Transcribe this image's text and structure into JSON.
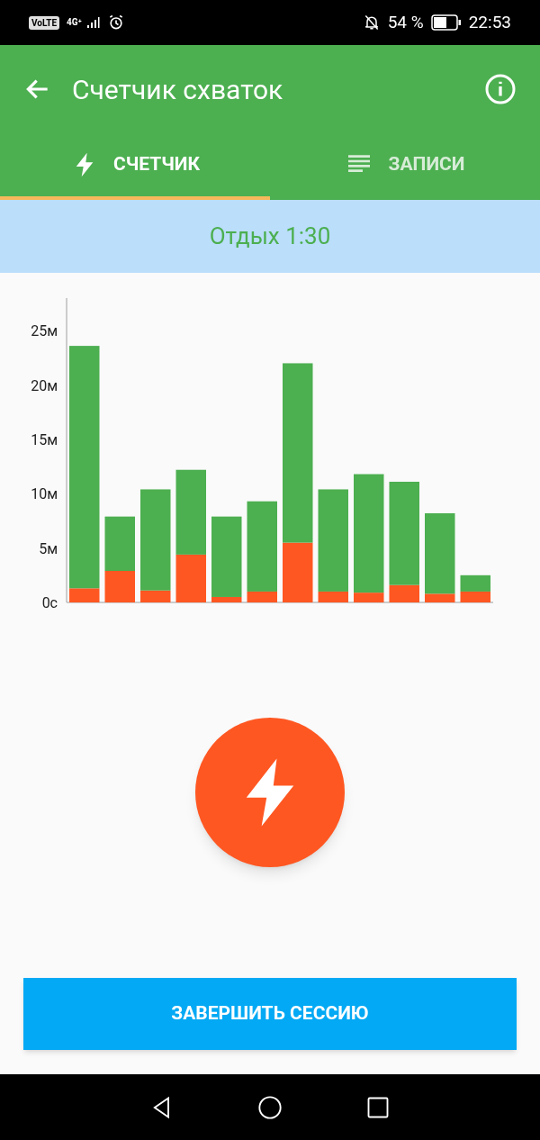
{
  "status_bar": {
    "volte": "VoLTE",
    "network": "4G⁺",
    "battery": "54 %",
    "time": "22:53"
  },
  "app_bar": {
    "title": "Счетчик схваток"
  },
  "tabs": [
    {
      "label": "СЧЕТЧИК",
      "kind": "bolt",
      "selected": true
    },
    {
      "label": "ЗАПИСИ",
      "kind": "lines",
      "selected": false
    }
  ],
  "banner": {
    "text": "Отдых 1:30"
  },
  "chart": {
    "chart_data": {
      "type": "bar",
      "stacked": true,
      "series": [
        {
          "color": "#ff5722",
          "values": [
            1.3,
            2.9,
            1.1,
            4.4,
            0.5,
            1.0,
            5.5,
            1.0,
            0.9,
            1.6,
            0.8,
            1.0
          ]
        },
        {
          "color": "#4caf50",
          "values": [
            22.3,
            5.0,
            9.3,
            7.8,
            7.4,
            8.3,
            16.5,
            9.4,
            10.9,
            9.5,
            7.4,
            1.5
          ]
        }
      ],
      "ylim": [
        0,
        28
      ],
      "yticks": [
        {
          "value": 0,
          "label": "0с"
        },
        {
          "value": 5,
          "label": "5м"
        },
        {
          "value": 10,
          "label": "10м"
        },
        {
          "value": 15,
          "label": "15м"
        },
        {
          "value": 20,
          "label": "20м"
        },
        {
          "value": 25,
          "label": "25м"
        }
      ]
    }
  },
  "end_button": {
    "label": "ЗАВЕРШИТЬ СЕССИЮ"
  }
}
